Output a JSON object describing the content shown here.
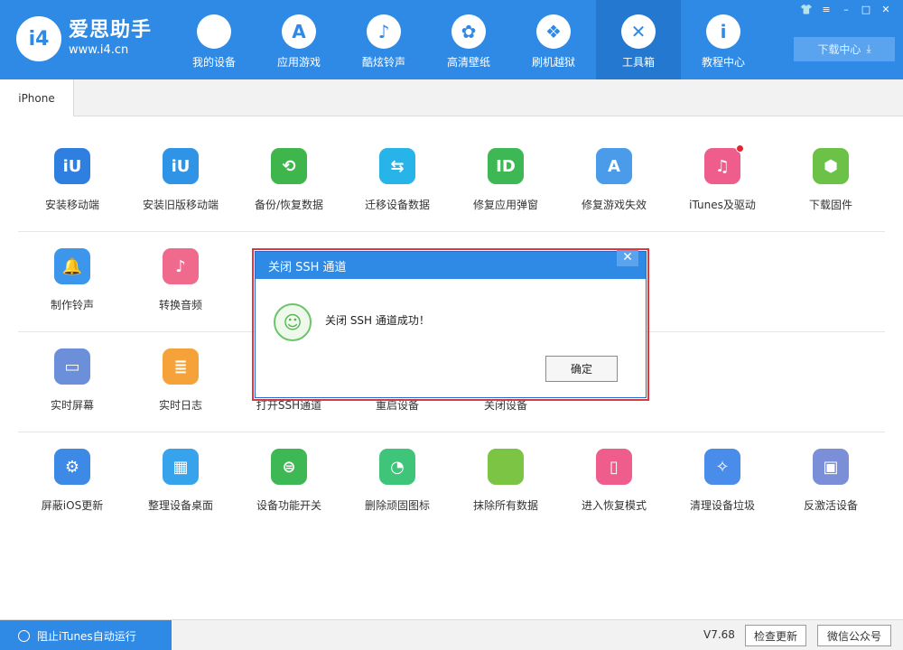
{
  "app": {
    "logo_mark": "i4",
    "name": "爱思助手",
    "url": "www.i4.cn"
  },
  "nav": [
    {
      "label": "我的设备",
      "glyph": "",
      "icon": "apple-icon"
    },
    {
      "label": "应用游戏",
      "glyph": "A",
      "icon": "app-store-icon"
    },
    {
      "label": "酷炫铃声",
      "glyph": "♪",
      "icon": "bell-icon"
    },
    {
      "label": "高清壁纸",
      "glyph": "✿",
      "icon": "flower-icon"
    },
    {
      "label": "刷机越狱",
      "glyph": "❖",
      "icon": "box-icon"
    },
    {
      "label": "工具箱",
      "glyph": "✕",
      "icon": "tools-icon"
    },
    {
      "label": "教程中心",
      "glyph": "i",
      "icon": "info-icon"
    }
  ],
  "window": {
    "skin": "👕",
    "menu": "≡",
    "minimize": "–",
    "maximize": "□",
    "close": "✕"
  },
  "download_center": {
    "label": "下载中心",
    "glyph": "⤓"
  },
  "tab": {
    "label": "iPhone"
  },
  "tools": {
    "row1": [
      {
        "label": "安装移动端",
        "glyph": "iU",
        "color": "#2f7fe0"
      },
      {
        "label": "安装旧版移动端",
        "glyph": "iU",
        "color": "#2f93e6"
      },
      {
        "label": "备份/恢复数据",
        "glyph": "⟲",
        "color": "#3fb64b"
      },
      {
        "label": "迁移设备数据",
        "glyph": "⇆",
        "color": "#27b4e8"
      },
      {
        "label": "修复应用弹窗",
        "glyph": "ID",
        "color": "#3db855"
      },
      {
        "label": "修复游戏失效",
        "glyph": "A",
        "color": "#4a9bea"
      },
      {
        "label": "iTunes及驱动",
        "glyph": "♫",
        "color": "#ef5d8c"
      },
      {
        "label": "下载固件",
        "glyph": "⬢",
        "color": "#6cc247"
      }
    ],
    "row2": [
      {
        "label": "制作铃声",
        "glyph": "🔔",
        "color": "#3c96ec"
      },
      {
        "label": "转换音频",
        "glyph": "♪",
        "color": "#f06a8d"
      }
    ],
    "row3": [
      {
        "label": "实时屏幕",
        "glyph": "▭",
        "color": "#6b8fd8"
      },
      {
        "label": "实时日志",
        "glyph": "≣",
        "color": "#f5a23b"
      },
      {
        "label": "打开SSH通道",
        "glyph": "",
        "color": "#ffffff"
      },
      {
        "label": "重启设备",
        "glyph": "",
        "color": "#ffffff"
      },
      {
        "label": "关闭设备",
        "glyph": "",
        "color": "#ffffff"
      }
    ],
    "row4": [
      {
        "label": "屏蔽iOS更新",
        "glyph": "⚙",
        "color": "#3c8ae6"
      },
      {
        "label": "整理设备桌面",
        "glyph": "▦",
        "color": "#37a3ec"
      },
      {
        "label": "设备功能开关",
        "glyph": "⊜",
        "color": "#3db855"
      },
      {
        "label": "删除顽固图标",
        "glyph": "◔",
        "color": "#3ec57a"
      },
      {
        "label": "抹除所有数据",
        "glyph": "",
        "color": "#7cc444"
      },
      {
        "label": "进入恢复模式",
        "glyph": "▯",
        "color": "#ef5d8c"
      },
      {
        "label": "清理设备垃圾",
        "glyph": "✧",
        "color": "#4a8cea"
      },
      {
        "label": "反激活设备",
        "glyph": "▣",
        "color": "#7a8fd8"
      }
    ]
  },
  "modal": {
    "title": "关闭 SSH 通道",
    "close": "✕",
    "smiley": "☺",
    "message": "关闭 SSH 通道成功！",
    "ok_label": "确定",
    "border_color": "#e0373e"
  },
  "footer": {
    "itunes_block_label": "阻止iTunes自动运行",
    "version": "V7.68",
    "check_update": "检查更新",
    "wechat": "微信公众号"
  },
  "colors": {
    "brand": "#2f8ae6",
    "brand_active": "#2578cf"
  }
}
